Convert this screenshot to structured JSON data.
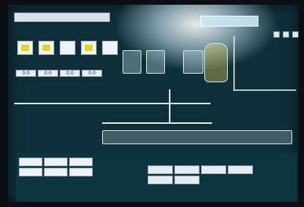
{
  "screen": {
    "title_box": "",
    "left_header": ""
  },
  "top_values": [
    {
      "text": "0.0"
    },
    {
      "text": "0.0"
    },
    {
      "text": "0.0"
    },
    {
      "text": "0.0"
    }
  ],
  "panel": {
    "buttons": [
      {
        "label": ""
      },
      {
        "label": ""
      },
      {
        "label": ""
      },
      {
        "label": ""
      },
      {
        "label": ""
      },
      {
        "label": ""
      },
      {
        "label": ""
      },
      {
        "label": ""
      },
      {
        "label": ""
      },
      {
        "label": ""
      },
      {
        "label": ""
      },
      {
        "label": ""
      }
    ]
  },
  "colors": {
    "screen_bg": "#0e2f38",
    "panel_bg": "#0d3540",
    "accent_yellow": "#e8d31a",
    "accent_blue": "#2a6bb9"
  },
  "icons": [
    "window-icon",
    "tank-icon",
    "valve-icon",
    "pump-icon"
  ]
}
